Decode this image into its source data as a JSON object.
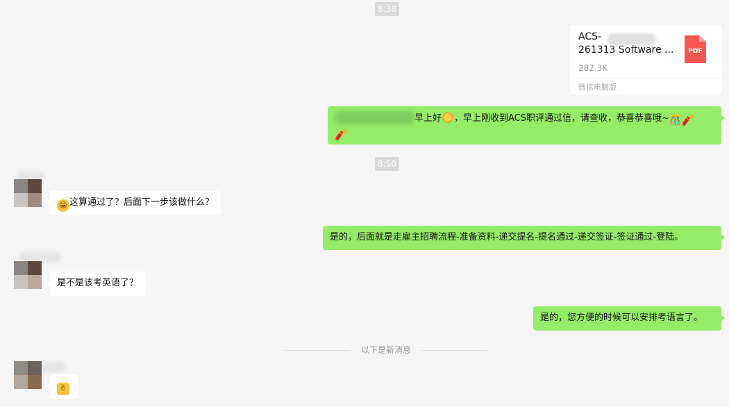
{
  "timestamps": [
    "8:38",
    "8:50"
  ],
  "file_message": {
    "name_line1": "ACS-",
    "name_line2": "261313 Software ...",
    "size": "282.3K",
    "source": "微信电脑版",
    "type_label": "PDF",
    "icon": "pdf-file-icon"
  },
  "messages": [
    {
      "side": "out",
      "text_after_name": "早上好",
      "text_rest": "，早上刚收到ACS职评通过信，请查收，恭喜恭喜哦~",
      "emojis": [
        "sun-emoji",
        "firecracker-emoji",
        "firecracker-emoji",
        "firecracker-emoji"
      ]
    },
    {
      "side": "in",
      "text": "这算通过了？后面下一步该做什么？",
      "emojis": [
        "grin-emoji"
      ]
    },
    {
      "side": "out",
      "text": "是的，后面就是走雇主招聘流程-准备资料-递交提名-提名通过-递交签证-签证通过-登陆。"
    },
    {
      "side": "in",
      "text": "是不是该考英语了？"
    },
    {
      "side": "out",
      "text": "是的，您方便的时候可以安排考语言了。"
    },
    {
      "side": "in",
      "text": "",
      "emojis": [
        "victory-hand-emoji"
      ]
    }
  ],
  "new_message_divider": "以下是新消息",
  "colors": {
    "background": "#f5f5f5",
    "outgoing_bubble": "#95ec69",
    "incoming_bubble": "#ffffff",
    "pdf_icon": "#f55750"
  }
}
